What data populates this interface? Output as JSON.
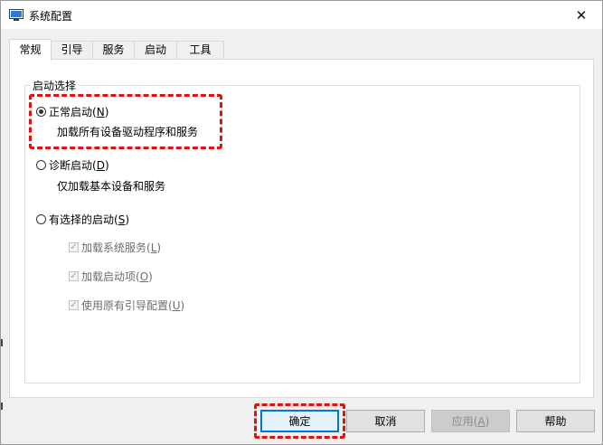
{
  "window": {
    "title": "系统配置"
  },
  "tabs": [
    {
      "label": "常规",
      "active": true
    },
    {
      "label": "引导",
      "active": false
    },
    {
      "label": "服务",
      "active": false
    },
    {
      "label": "启动",
      "active": false
    },
    {
      "label": "工具",
      "active": false
    }
  ],
  "startup": {
    "group_title": "启动选择",
    "options": [
      {
        "label": "正常启动",
        "key": "N",
        "description": "加载所有设备驱动程序和服务",
        "checked": true
      },
      {
        "label": "诊断启动",
        "key": "D",
        "description": "仅加载基本设备和服务",
        "checked": false
      },
      {
        "label": "有选择的启动",
        "key": "S",
        "description": "",
        "checked": false
      }
    ],
    "selective_items": [
      {
        "label": "加载系统服务",
        "key": "L",
        "checked": true
      },
      {
        "label": "加载启动项",
        "key": "O",
        "checked": true
      },
      {
        "label": "使用原有引导配置",
        "key": "U",
        "checked": true
      }
    ]
  },
  "buttons": {
    "ok": "确定",
    "cancel": "取消",
    "apply": "应用",
    "apply_key": "A",
    "help": "帮助"
  },
  "colors": {
    "highlight": "#e01111",
    "default_button_border": "#0078d7",
    "window_background": "#f0f0f0"
  }
}
